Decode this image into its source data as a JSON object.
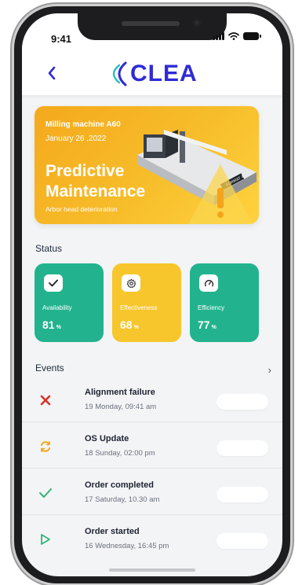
{
  "status_bar": {
    "time": "9:41"
  },
  "header": {
    "logo_text": "CLEA"
  },
  "banner": {
    "machine": "Milling machine A60",
    "date": "January 26 ,2022",
    "title_line1": "Predictive",
    "title_line2": "Maintenance",
    "note": "Arbor head deterioration"
  },
  "status": {
    "section_title": "Status",
    "cards": [
      {
        "label": "Availability",
        "value": "81",
        "unit": "%",
        "icon": "check-icon",
        "color": "#22b38e"
      },
      {
        "label": "Effectiveness",
        "value": "68",
        "unit": "%",
        "icon": "gear-icon",
        "color": "#f7c62c"
      },
      {
        "label": "Efficiency",
        "value": "77",
        "unit": "%",
        "icon": "gauge-icon",
        "color": "#22b38e"
      }
    ]
  },
  "events": {
    "section_title": "Events",
    "items": [
      {
        "title": "Alignment failure",
        "date": "19 Monday, 09:41 am",
        "icon": "x-icon",
        "color": "#d8342a"
      },
      {
        "title": "OS Update",
        "date": "18 Sunday, 02:00 pm",
        "icon": "refresh-icon",
        "color": "#f2a81d"
      },
      {
        "title": "Order completed",
        "date": "17 Saturday, 10.30 am",
        "icon": "check-icon",
        "color": "#34b37a"
      },
      {
        "title": "Order started",
        "date": "16 Wednesday, 16:45 pm",
        "icon": "play-icon",
        "color": "#34b37a"
      }
    ]
  },
  "colors": {
    "brand": "#2f2bd8",
    "banner": "#f7bd2a"
  }
}
